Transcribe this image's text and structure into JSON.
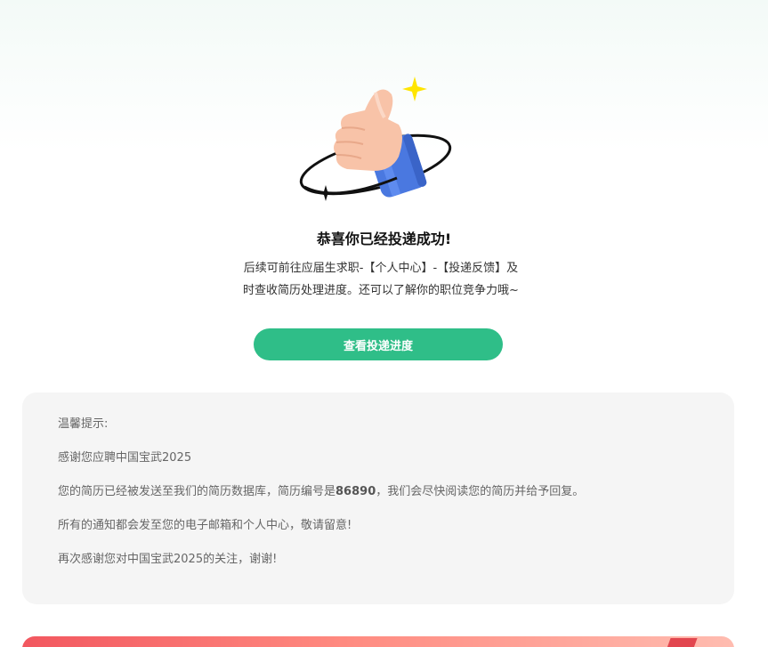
{
  "success": {
    "title": "恭喜你已经投递成功!",
    "desc_line1": "后续可前往应届生求职-【个人中心】-【投递反馈】及",
    "desc_line2": "时查收简历处理进度。还可以了解你的职位竞争力哦~",
    "button_label": "查看投递进度"
  },
  "notice": {
    "title": "温馨提示:",
    "line1": "感谢您应聘中国宝武2025",
    "line2_prefix": "您的简历已经被发送至我们的简历数据库，简历编号是",
    "resume_number": "86890",
    "line2_suffix": "，我们会尽快阅读您的简历并给予回复。",
    "line3": "所有的通知都会发至您的电子邮箱和个人中心，敬请留意!",
    "line4": "再次感谢您对中国宝武2025的关注，谢谢!"
  },
  "colors": {
    "accent": "#2fbe88",
    "card_bg": "#f5f5f5",
    "banner": "#f2575f"
  },
  "icons": {
    "hero": "thumbs-up-icon",
    "sparkle": "sparkle-icon"
  }
}
